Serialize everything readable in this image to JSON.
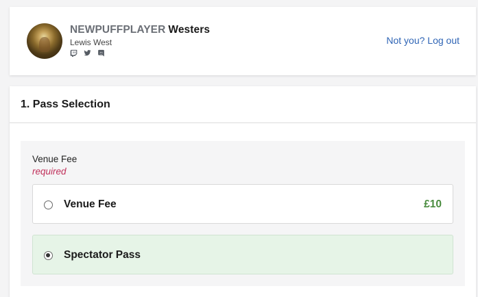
{
  "profile": {
    "gamertag": "NEWPUFFPLAYER",
    "surname": "Westers",
    "real_name": "Lewis West",
    "social_icons": [
      "twitch-icon",
      "twitter-icon",
      "discord-icon"
    ],
    "logout_label": "Not you? Log out"
  },
  "pass_section": {
    "title": "1. Pass Selection",
    "field_label": "Venue Fee",
    "required_label": "required",
    "options": [
      {
        "name": "Venue Fee",
        "price": "£10",
        "selected": false
      },
      {
        "name": "Spectator Pass",
        "price": "",
        "selected": true
      }
    ]
  },
  "colors": {
    "link": "#2e64b5",
    "price": "#4a8c3f",
    "required": "#c0305a",
    "selected_bg": "#e6f4e7"
  }
}
